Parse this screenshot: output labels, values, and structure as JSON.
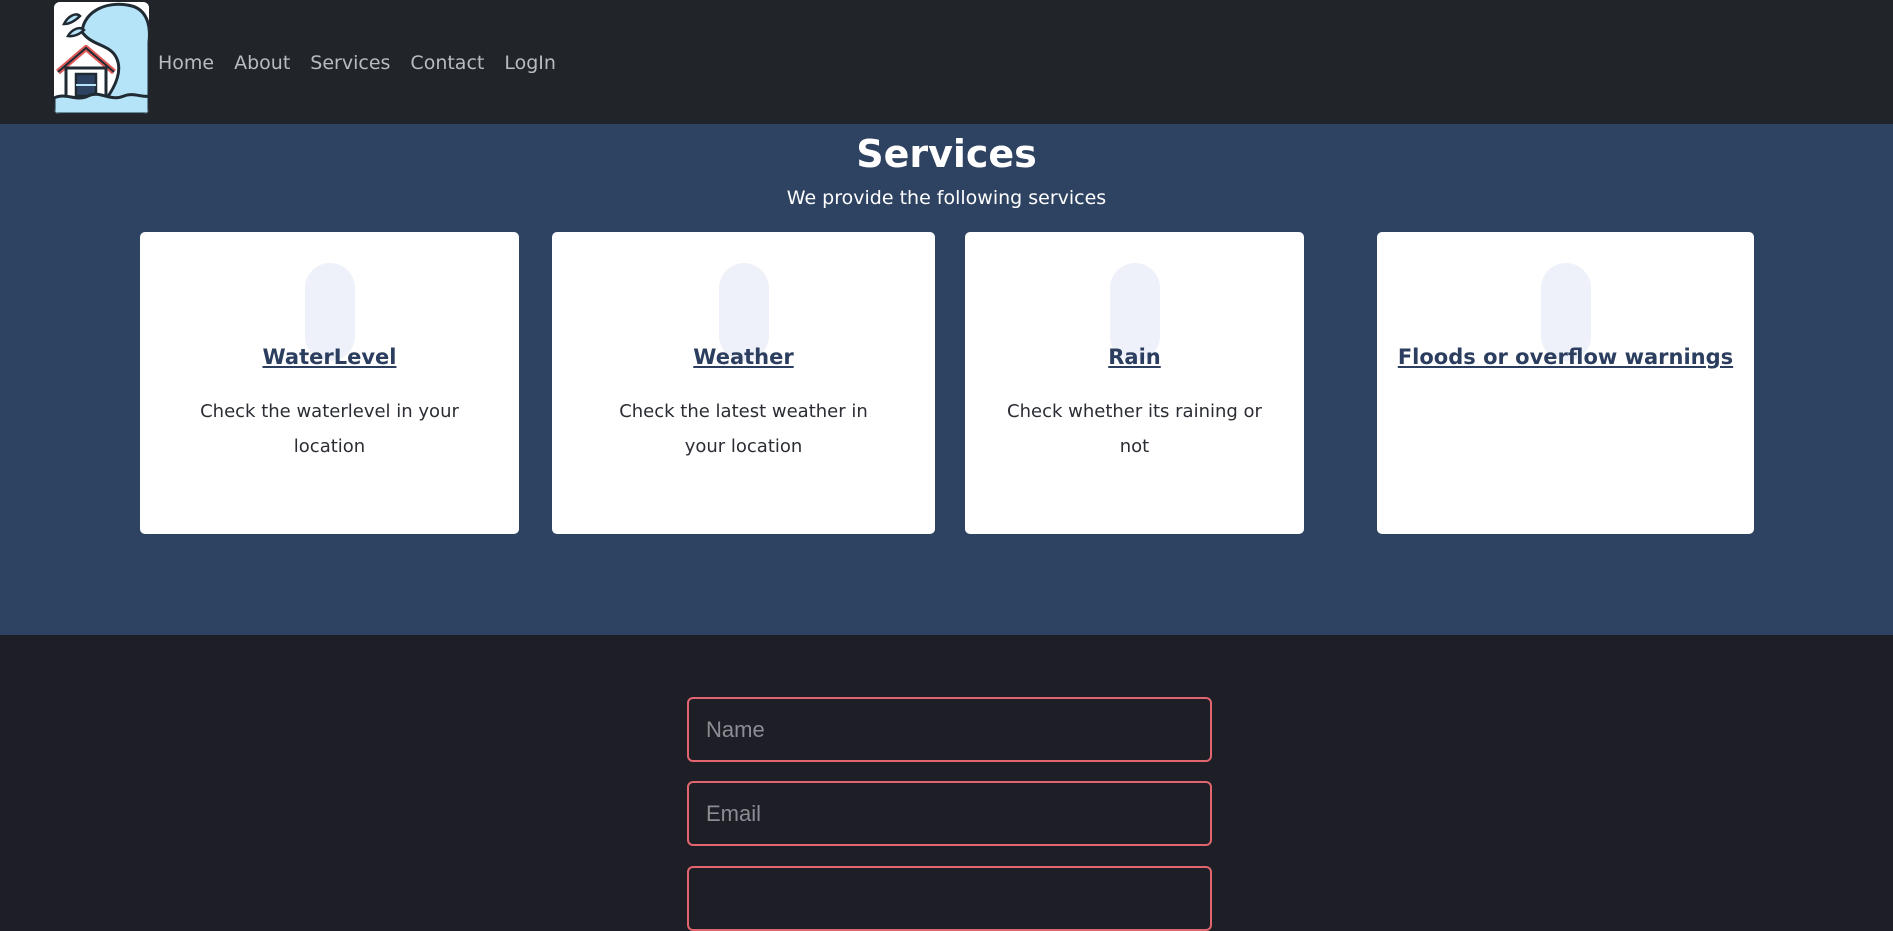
{
  "nav": {
    "links": [
      "Home",
      "About",
      "Services",
      "Contact",
      "LogIn"
    ]
  },
  "services": {
    "title": "Services",
    "subtitle": "We provide the following services",
    "cards": [
      {
        "title": "WaterLevel",
        "text": "Check the waterlevel in your location"
      },
      {
        "title": "Weather",
        "text": "Check the latest weather in your location"
      },
      {
        "title": "Rain",
        "text": "Check whether its raining or not"
      },
      {
        "title": "Floods or overflow warnings",
        "text": ""
      }
    ]
  },
  "form": {
    "name_placeholder": "Name",
    "email_placeholder": "Email"
  },
  "colors": {
    "navbar_bg": "#212529",
    "services_bg": "#2e4262",
    "footer_bg": "#1e1f26",
    "input_border": "#e0656f",
    "card_title": "#2c3e5f"
  },
  "icons": {
    "logo": "flood-house-icon"
  }
}
